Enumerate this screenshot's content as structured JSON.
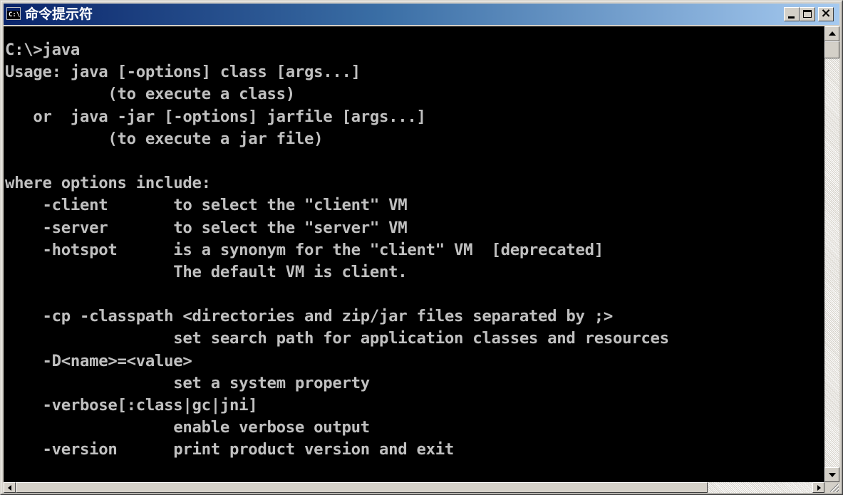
{
  "window": {
    "title": "命令提示符",
    "icon_text": "C:\\",
    "icon": "console-icon"
  },
  "titlebar_buttons": {
    "minimize": "minimize-icon",
    "maximize": "maximize-icon",
    "close": "close-icon",
    "close_glyph": "×"
  },
  "console": {
    "background_color": "#000000",
    "text_color": "#c0c0c0",
    "lines": [
      "C:\\>java",
      "Usage: java [-options] class [args...]",
      "           (to execute a class)",
      "   or  java -jar [-options] jarfile [args...]",
      "           (to execute a jar file)",
      "",
      "where options include:",
      "    -client       to select the \"client\" VM",
      "    -server       to select the \"server\" VM",
      "    -hotspot      is a synonym for the \"client\" VM  [deprecated]",
      "                  The default VM is client.",
      "",
      "    -cp -classpath <directories and zip/jar files separated by ;>",
      "                  set search path for application classes and resources",
      "    -D<name>=<value>",
      "                  set a system property",
      "    -verbose[:class|gc|jni]",
      "                  enable verbose output",
      "    -version      print product version and exit"
    ]
  },
  "scrollbars": {
    "vertical": {
      "up_icon": "scroll-up-arrow-icon",
      "down_icon": "scroll-down-arrow-icon"
    },
    "horizontal": {
      "left_icon": "scroll-left-arrow-icon",
      "right_icon": "scroll-right-arrow-icon"
    }
  }
}
